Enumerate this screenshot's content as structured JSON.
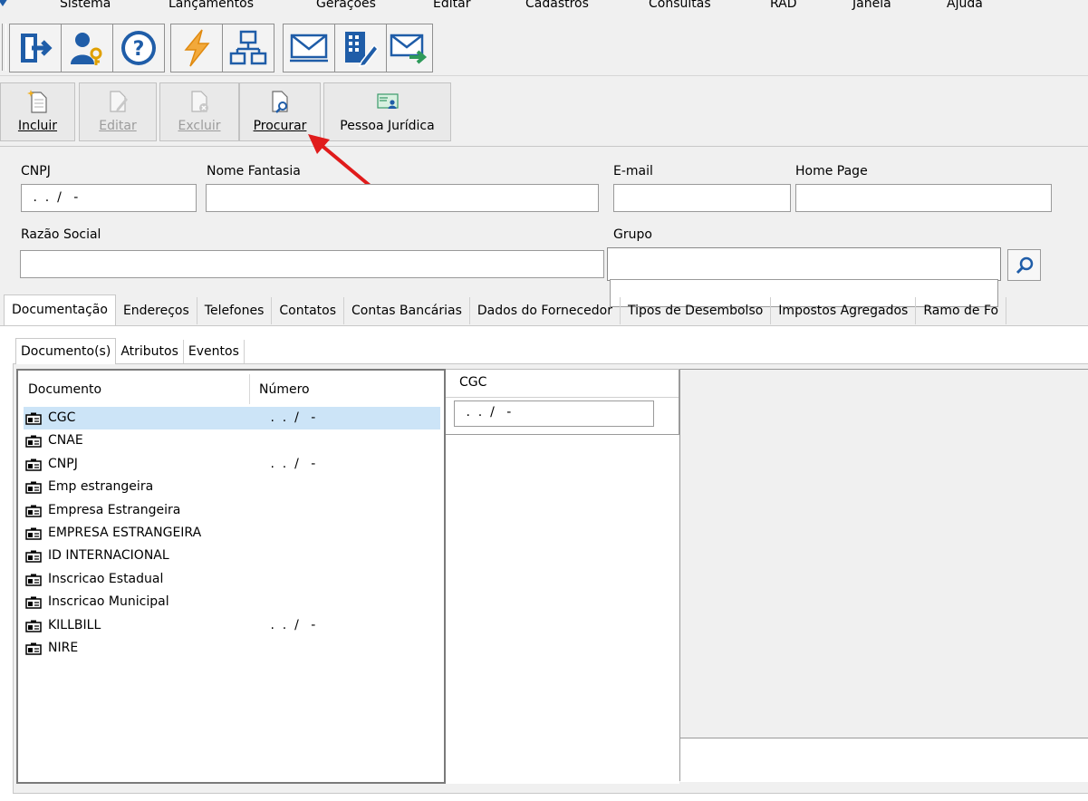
{
  "menu": [
    "Sistema",
    "Lançamentos",
    "Gerações",
    "Editar",
    "Cadastros",
    "Consultas",
    "RAD",
    "Janela",
    "Ajuda"
  ],
  "actions": {
    "incluir": "Incluir",
    "editar": "Editar",
    "excluir": "Excluir",
    "procurar": "Procurar",
    "pessoa_juridica": "Pessoa Jurídica"
  },
  "form": {
    "cnpj_label": "CNPJ",
    "cnpj_value": " .  .  /   -",
    "nome_fantasia_label": "Nome Fantasia",
    "email_label": "E-mail",
    "home_page_label": "Home Page",
    "razao_social_label": "Razão Social",
    "grupo_label": "Grupo"
  },
  "tabs": [
    "Documentação",
    "Endereços",
    "Telefones",
    "Contatos",
    "Contas Bancárias",
    "Dados do Fornecedor",
    "Tipos de Desembolso",
    "Impostos Agregados",
    "Ramo de Fo"
  ],
  "subtabs": [
    "Documento(s)",
    "Atributos",
    "Eventos"
  ],
  "documents": {
    "col_documento": "Documento",
    "col_numero": "Número",
    "rows": [
      {
        "name": "CGC",
        "number": " .  .  /   -"
      },
      {
        "name": "CNAE",
        "number": ""
      },
      {
        "name": "CNPJ",
        "number": " .  .  /   -"
      },
      {
        "name": "Emp estrangeira",
        "number": ""
      },
      {
        "name": "Empresa Estrangeira",
        "number": ""
      },
      {
        "name": "EMPRESA ESTRANGEIRA",
        "number": ""
      },
      {
        "name": "ID INTERNACIONAL",
        "number": ""
      },
      {
        "name": "Inscricao Estadual",
        "number": ""
      },
      {
        "name": "Inscricao Municipal",
        "number": ""
      },
      {
        "name": "KILLBILL",
        "number": " .  .  /   -"
      },
      {
        "name": "NIRE",
        "number": ""
      }
    ]
  },
  "detail": {
    "label": "CGC",
    "value": " .  .  /   -"
  },
  "colors": {
    "accent_arrow": "#e01b1b",
    "selection": "#cce4f7",
    "icon_blue": "#1f5da8"
  }
}
